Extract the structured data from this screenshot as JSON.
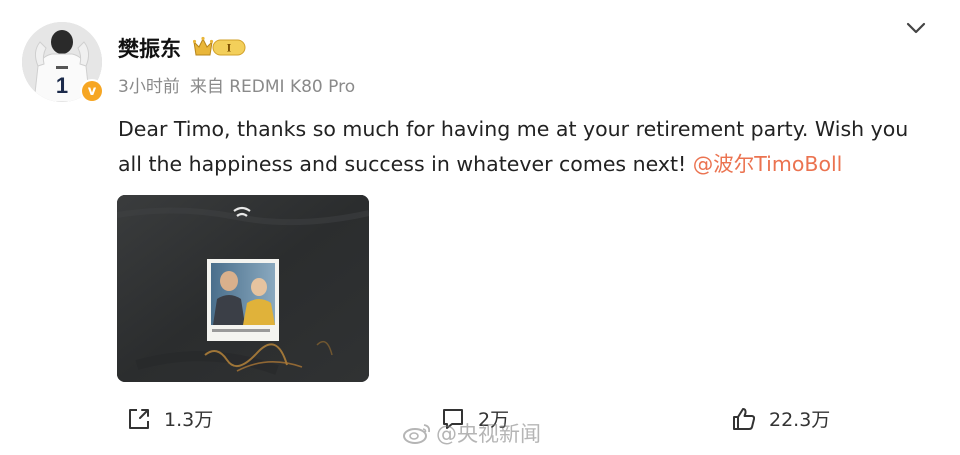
{
  "post": {
    "author": {
      "name": "樊振东",
      "vip_badge_text": "I",
      "verified_badge_text": "v",
      "avatar_jersey_number": "1"
    },
    "time": "3小时前",
    "source": "来自 REDMI K80 Pro",
    "text": "Dear Timo, thanks so much for having me at your retirement party. Wish you all the happiness and success in whatever comes next! ",
    "mention": "@波尔TimoBoll"
  },
  "actions": {
    "repost_count": "1.3万",
    "comment_count": "2万",
    "like_count": "22.3万"
  },
  "watermark": {
    "text": "@央视新闻"
  },
  "colors": {
    "mention": "#eb7350",
    "verified": "#f6a623",
    "vip_gold": "#e9b63a",
    "meta_gray": "#8a8a8a"
  },
  "icons": {
    "more": "chevron-down-icon",
    "repost": "share-icon",
    "comment": "comment-icon",
    "like": "thumbs-up-icon",
    "watermark": "weibo-logo-icon"
  }
}
